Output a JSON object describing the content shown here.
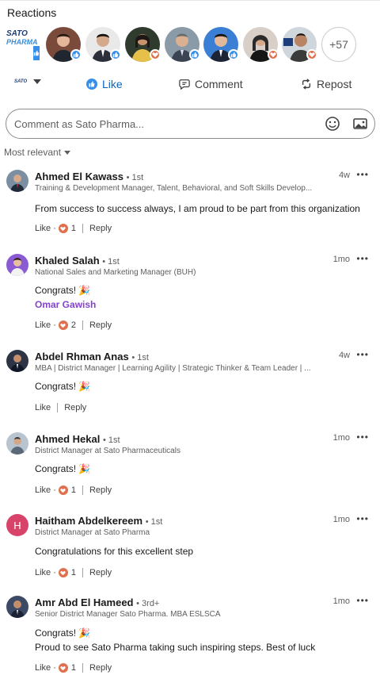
{
  "reactions": {
    "title": "Reactions",
    "logo_name_top": "SATO",
    "logo_name_bottom": "PHARMA",
    "more_count": "+57"
  },
  "actions": {
    "actor_logo": "SATO",
    "like": "Like",
    "comment": "Comment",
    "repost": "Repost"
  },
  "comment_box": {
    "placeholder": "Comment as Sato Pharma..."
  },
  "sort": {
    "label": "Most relevant"
  },
  "comments": [
    {
      "name": "Ahmed El Kawass",
      "degree": "• 1st",
      "headline": "Training & Development Manager, Talent, Behavioral, and Soft Skills Develop...",
      "time": "4w",
      "text": "From success to success always, I am proud to be part from this organization",
      "like": "Like",
      "dot": "·",
      "reaction_count": "1",
      "reply": "Reply"
    },
    {
      "name": "Khaled Salah",
      "degree": "• 1st",
      "headline": "National Sales and Marketing Manager (BUH)",
      "time": "1mo",
      "text": "Congrats! 🎉",
      "mention": "Omar Gawish",
      "like": "Like",
      "dot": "·",
      "reaction_count": "2",
      "reply": "Reply"
    },
    {
      "name": "Abdel Rhman Anas",
      "degree": "• 1st",
      "headline": "MBA | District Manager | Learning Agility | Strategic Thinker & Team Leader | ...",
      "time": "4w",
      "text": "Congrats! 🎉",
      "like": "Like",
      "reply": "Reply"
    },
    {
      "name": "Ahmed Hekal",
      "degree": "• 1st",
      "headline": "District Manager at Sato Pharmaceuticals",
      "time": "1mo",
      "text": "Congrats! 🎉",
      "like": "Like",
      "dot": "·",
      "reaction_count": "1",
      "reply": "Reply"
    },
    {
      "name": "Haitham Abdelkereem",
      "degree": "• 1st",
      "headline": "District Manager at Sato Pharma",
      "time": "1mo",
      "avatar_letter": "H",
      "text": "Congratulations for this excellent step",
      "like": "Like",
      "dot": "·",
      "reaction_count": "1",
      "reply": "Reply"
    },
    {
      "name": "Amr Abd El Hameed",
      "degree": "• 3rd+",
      "headline": "Senior District Manager Sato Pharma. MBA ESLSCA",
      "time": "1mo",
      "text": "Congrats! 🎉",
      "text2": "Proud to see Sato Pharma taking such inspiring steps. Best of luck",
      "like": "Like",
      "dot": "·",
      "reaction_count": "1",
      "reply": "Reply"
    }
  ],
  "colors": {
    "like_blue": "#0a66c2",
    "love_orange": "#df704d",
    "mention_purple": "#8344cc",
    "avatar_h_pink": "#d8436a"
  }
}
